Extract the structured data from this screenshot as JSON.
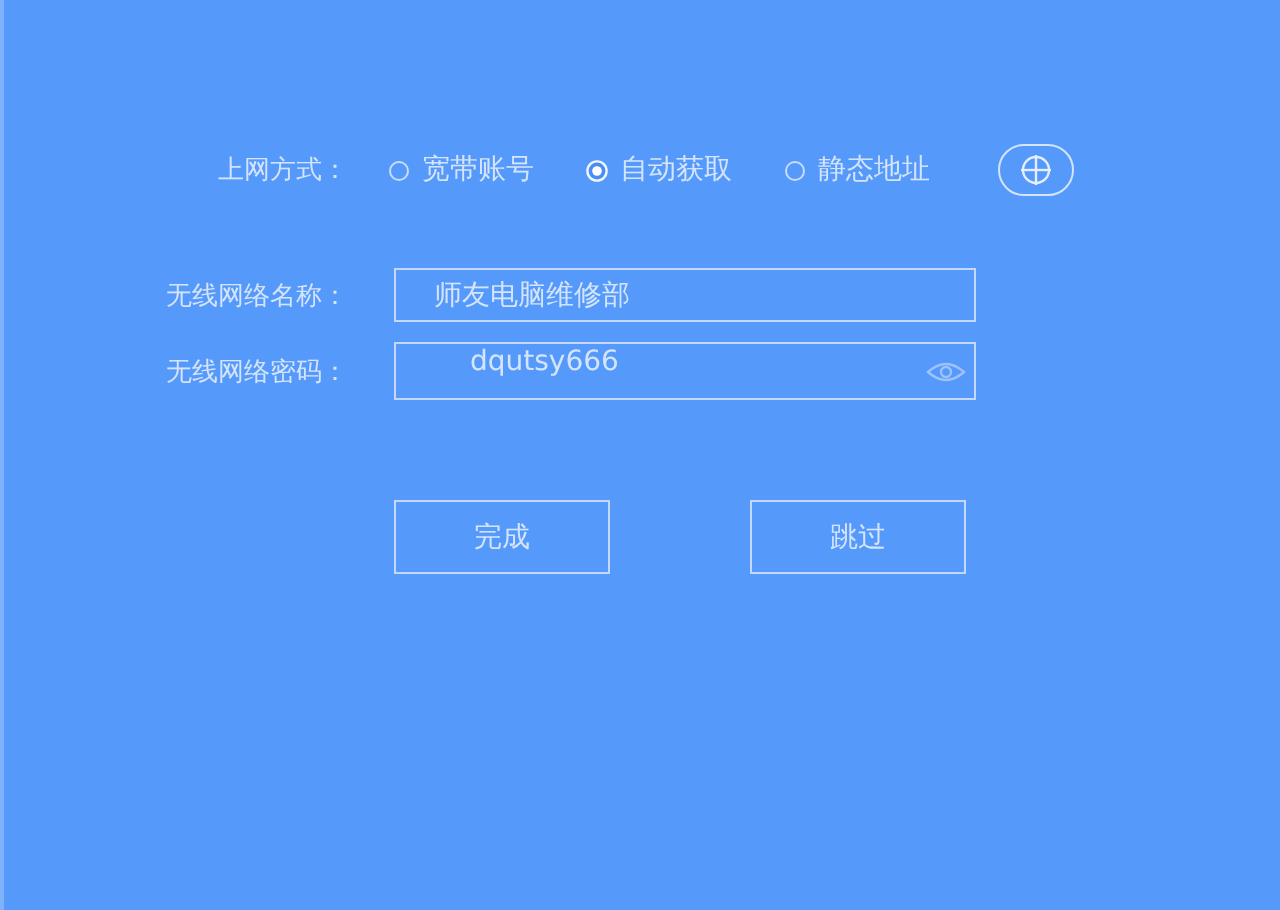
{
  "connection_type": {
    "label": "上网方式：",
    "options": [
      {
        "label": "宽带账号",
        "selected": false
      },
      {
        "label": "自动获取",
        "selected": true
      },
      {
        "label": "静态地址",
        "selected": false
      }
    ]
  },
  "wifi_name": {
    "label": "无线网络名称：",
    "value": "师友电脑维修部"
  },
  "wifi_password": {
    "label": "无线网络密码：",
    "value": "dqutsy666"
  },
  "buttons": [
    {
      "label": "完成"
    },
    {
      "label": "跳过"
    }
  ]
}
